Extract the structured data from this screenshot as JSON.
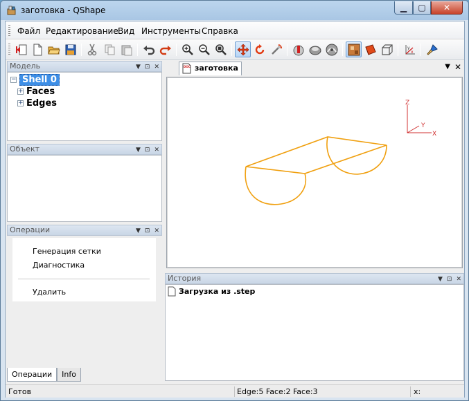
{
  "window": {
    "title": "заготовка - QShape"
  },
  "menu": [
    "Файл",
    "Редактирование",
    "Вид",
    "Инструменты",
    "Справка"
  ],
  "toolbar": {
    "icons": [
      "close-doc-icon",
      "new-doc-icon",
      "open-folder-icon",
      "save-icon",
      "cut-icon",
      "copy-icon",
      "paste-icon",
      "undo-icon",
      "redo-icon",
      "zoom-in-icon",
      "zoom-out-icon",
      "zoom-fit-icon",
      "pan-icon",
      "rotate-icon",
      "rotate-tool-icon",
      "edge-tool-icon",
      "face-tool-icon",
      "shape-tool-icon",
      "shaded-view-icon",
      "surface-view-icon",
      "wireframe-view-icon",
      "axes-icon",
      "brush-icon"
    ]
  },
  "model_panel": {
    "title": "Модель",
    "tree": [
      {
        "label": "Shell 0",
        "selected": true
      },
      {
        "label": "Faces"
      },
      {
        "label": "Edges"
      }
    ]
  },
  "object_panel": {
    "title": "Объект"
  },
  "operations_panel": {
    "title": "Операции",
    "items": [
      "Генерация сетки",
      "Диагностика",
      "Удалить"
    ]
  },
  "left_tabs": [
    "Операции",
    "Info"
  ],
  "document_tab": {
    "label": "заготовка"
  },
  "viewport": {
    "axis_labels": {
      "z": "Z",
      "y": "Y",
      "x": "X"
    },
    "colors": {
      "wire": "#f0a010",
      "axis": "#d03030"
    }
  },
  "history_panel": {
    "title": "История",
    "items": [
      "Загрузка из .step"
    ]
  },
  "status": {
    "left": "Готов",
    "middle": "Edge:5 Face:2 Face:3",
    "right": "x:"
  }
}
